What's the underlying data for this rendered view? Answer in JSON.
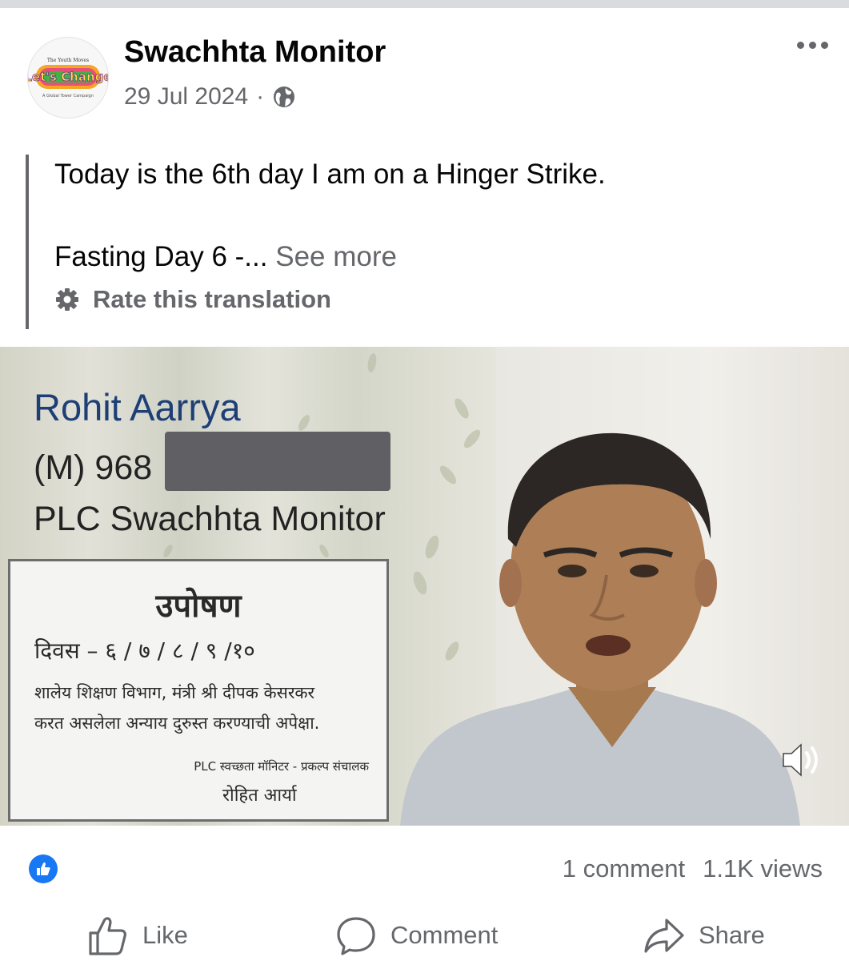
{
  "post": {
    "author": "Swachhta Monitor",
    "date": "29 Jul 2024",
    "separator": "·",
    "line1": "Today is the 6th day I am on a Hinger Strike.",
    "line2": "Fasting Day 6 -...",
    "see_more": "See more",
    "rate_translation": "Rate this translation"
  },
  "avatar": {
    "top_text": "The Youth Moves",
    "logo_text": "Let's Change",
    "bottom_text": "A Global Tower Campaign"
  },
  "video": {
    "name": "Rohit Aarrya",
    "mobile": "(M) 968",
    "org": "PLC Swachhta Monitor",
    "sign": {
      "title": "उपोषण",
      "date": "दिवस – ६ / ७ / ८ / ९ /१०",
      "line1": "शालेय शिक्षण विभाग, मंत्री श्री दीपक केसरकर",
      "line2": "करत असलेला अन्याय दुरुस्त करण्याची अपेक्षा.",
      "line3": "PLC स्वच्छता मॉनिटर - प्रकल्प संचालक",
      "line4": "रोहित आर्या"
    }
  },
  "stats": {
    "comments": "1 comment",
    "views": "1.1K views"
  },
  "actions": {
    "like": "Like",
    "comment": "Comment",
    "share": "Share"
  },
  "colors": {
    "facebook_blue": "#1877f2",
    "secondary_text": "#65676b",
    "name_text": "#1d3f76"
  }
}
